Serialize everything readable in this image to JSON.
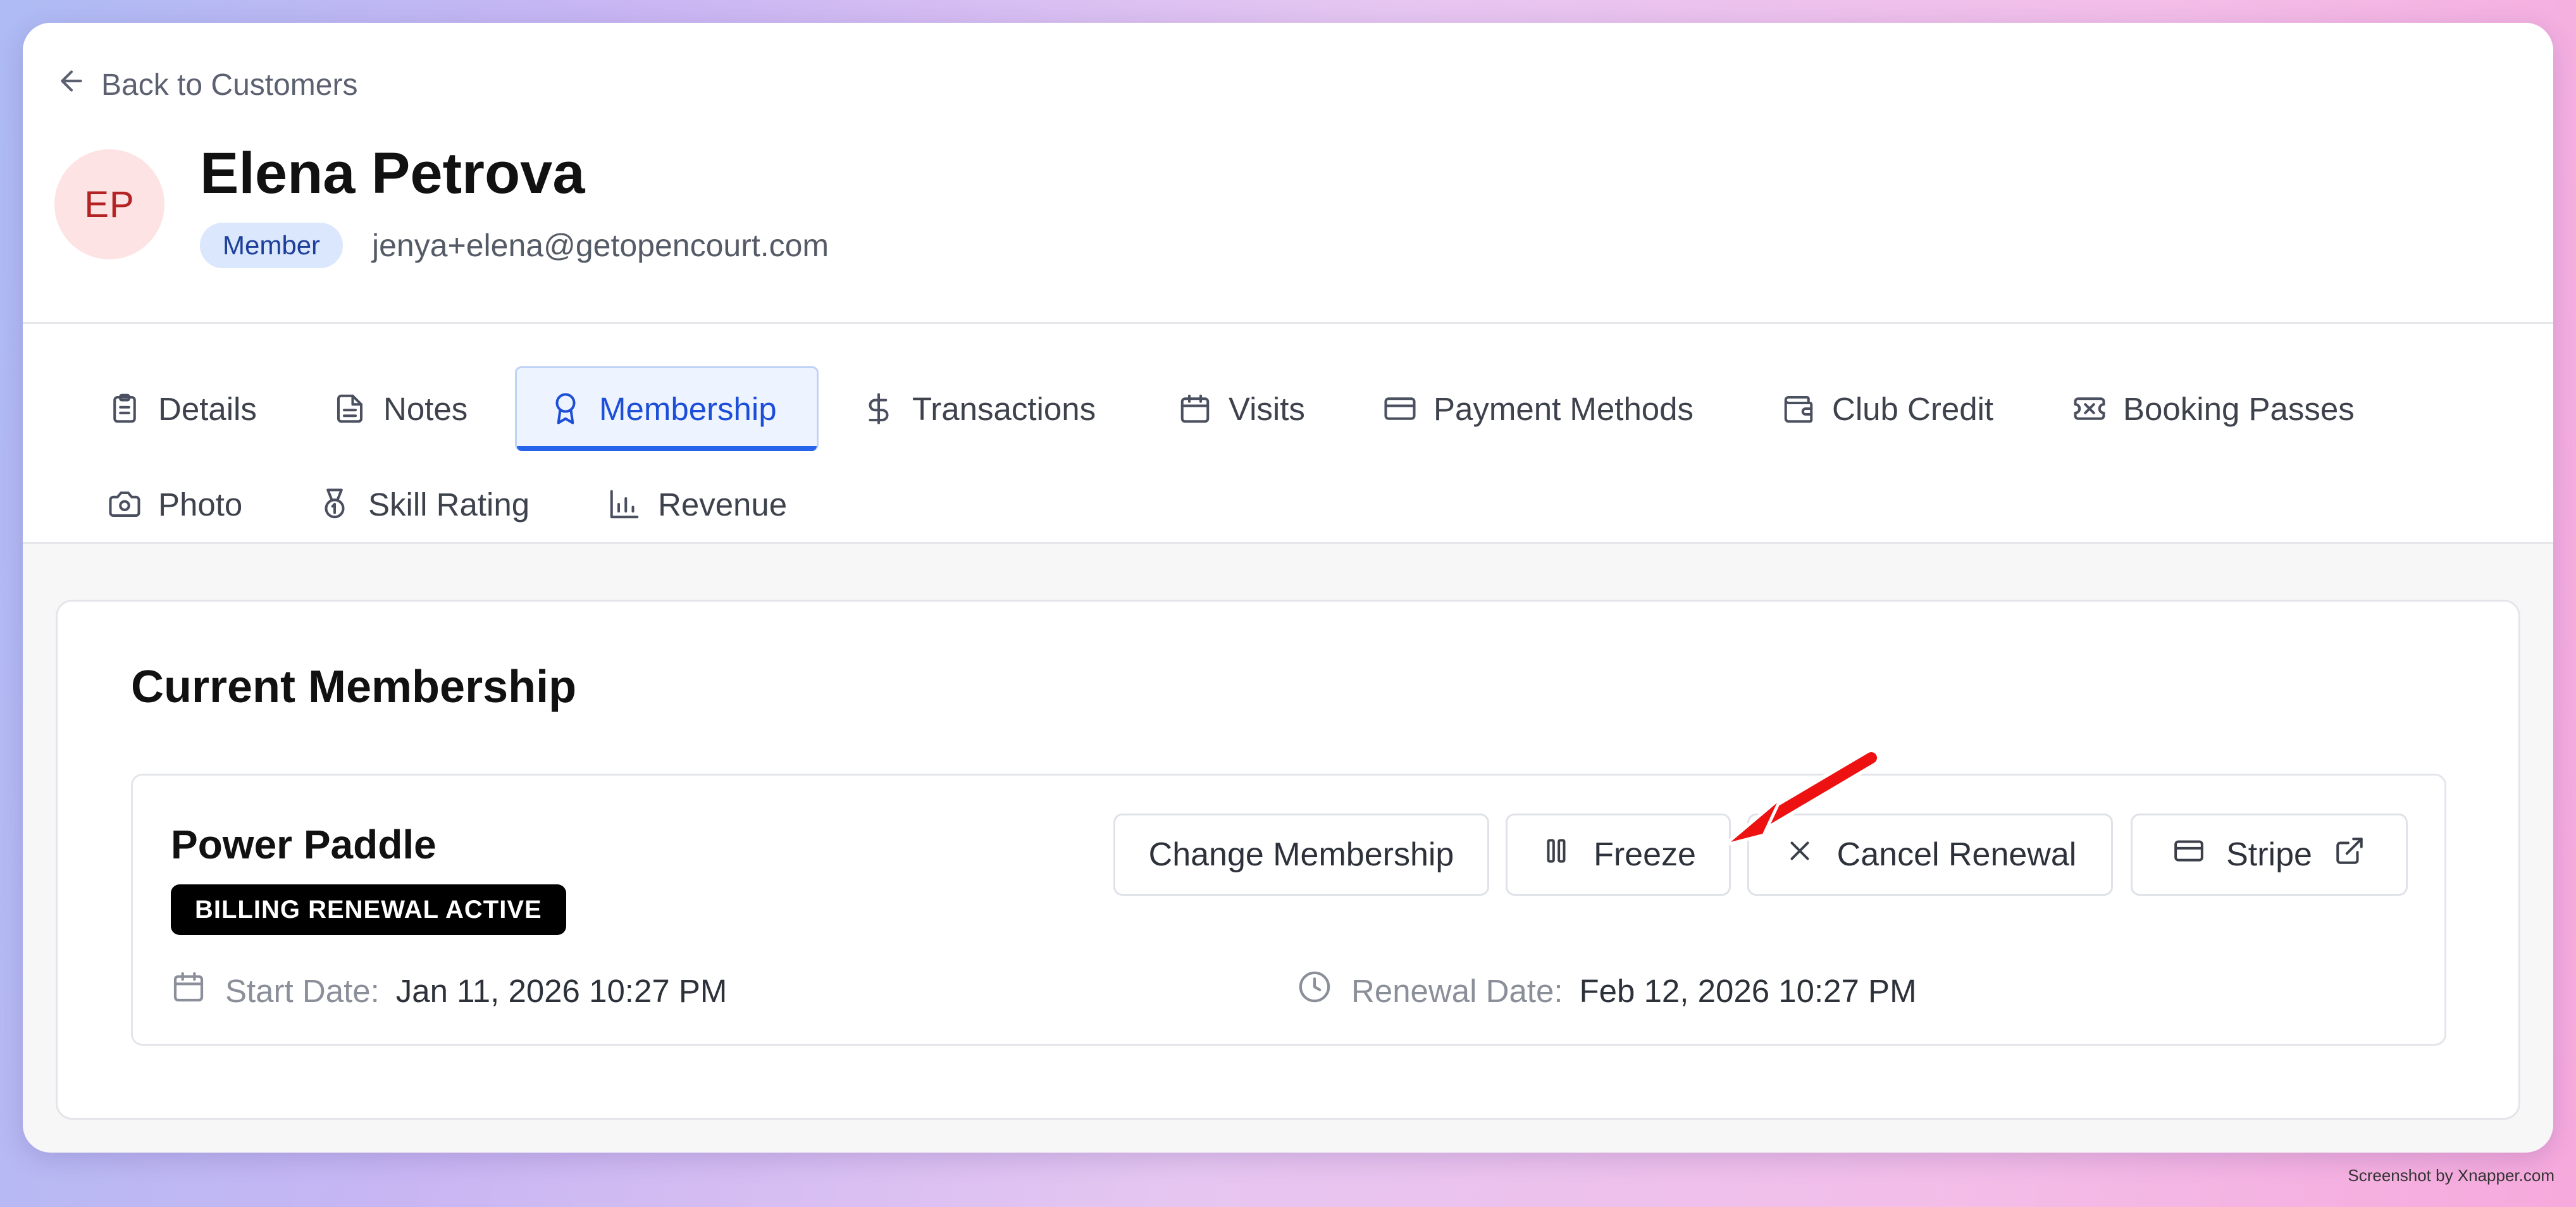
{
  "header": {
    "back_label": "Back to Customers",
    "avatar_initials": "EP",
    "customer_name": "Elena Petrova",
    "role_badge": "Member",
    "email": "jenya+elena@getopencourt.com"
  },
  "tabs": [
    {
      "label": "Details",
      "icon": "clipboard-icon",
      "active": false
    },
    {
      "label": "Notes",
      "icon": "document-icon",
      "active": false
    },
    {
      "label": "Membership",
      "icon": "award-icon",
      "active": true
    },
    {
      "label": "Transactions",
      "icon": "dollar-icon",
      "active": false
    },
    {
      "label": "Visits",
      "icon": "calendar-icon",
      "active": false
    },
    {
      "label": "Payment Methods",
      "icon": "credit-card-icon",
      "active": false
    },
    {
      "label": "Club Credit",
      "icon": "wallet-icon",
      "active": false
    },
    {
      "label": "Booking Passes",
      "icon": "ticket-icon",
      "active": false
    },
    {
      "label": "Photo",
      "icon": "camera-icon",
      "active": false
    },
    {
      "label": "Skill Rating",
      "icon": "medal-icon",
      "active": false
    },
    {
      "label": "Revenue",
      "icon": "bar-chart-icon",
      "active": false
    }
  ],
  "membership": {
    "section_title": "Current Membership",
    "plan_name": "Power Paddle",
    "status_badge": "BILLING RENEWAL ACTIVE",
    "buttons": {
      "change": "Change Membership",
      "freeze": "Freeze",
      "cancel_renewal": "Cancel Renewal",
      "stripe": "Stripe"
    },
    "start_date_label": "Start Date:",
    "start_date_value": "Jan 11, 2026 10:27 PM",
    "renewal_date_label": "Renewal Date:",
    "renewal_date_value": "Feb 12, 2026 10:27 PM"
  },
  "annotation": {
    "arrow_color": "#ee1111",
    "points_to": "freeze-button"
  },
  "colors": {
    "accent": "#2563eb",
    "active_tab_bg": "#eef4ff",
    "badge_bg": "#000000",
    "role_badge_bg": "#dbe7fc",
    "avatar_bg": "#fde3e3"
  },
  "watermark": "Screenshot by Xnapper.com"
}
